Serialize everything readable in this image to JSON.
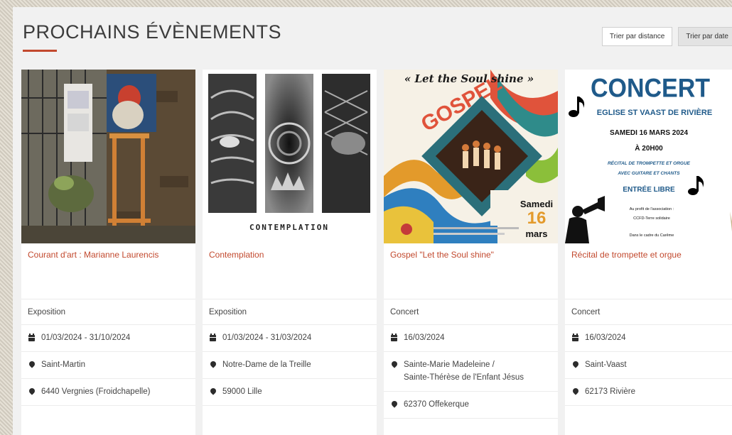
{
  "header": {
    "title": "PROCHAINS ÉVÈNEMENTS",
    "sort_distance": "Trier par distance",
    "sort_date": "Trier par date"
  },
  "colors": {
    "accent": "#c2492e",
    "text": "#444444",
    "panel": "#f1f1f1"
  },
  "events": [
    {
      "title": "Courant d'art : Marianne Laurencis",
      "category": "Exposition",
      "dates": "01/03/2024 - 31/10/2024",
      "place": "Saint-Martin",
      "place_line2": "",
      "locality": "6440 Vergnies (Froidchapelle)"
    },
    {
      "title": "Contemplation",
      "category": "Exposition",
      "dates": "01/03/2024 - 31/03/2024",
      "place": "Notre-Dame de la Treille",
      "place_line2": "",
      "locality": "59000 Lille",
      "poster_caption": "CONTEMPLATION"
    },
    {
      "title": "Gospel \"Let the Soul shine\"",
      "category": "Concert",
      "dates": "16/03/2024",
      "place": "Sainte-Marie Madeleine /",
      "place_line2": "Sainte-Thérèse de l'Enfant Jésus",
      "locality": "62370 Offekerque",
      "poster": {
        "script": "« Let the Soul shine »",
        "word": "GOSPEL",
        "day": "Samedi",
        "num": "16",
        "month": "mars"
      }
    },
    {
      "title": "Récital de trompette et orgue",
      "category": "Concert",
      "dates": "16/03/2024",
      "place": "Saint-Vaast",
      "place_line2": "",
      "locality": "62173 Rivière",
      "poster": {
        "heading": "CONCERT",
        "church": "EGLISE ST VAAST DE RIVIÈRE",
        "date": "SAMEDI 16 MARS 2024",
        "time": "À 20H00",
        "line1": "RÉCITAL DE TROMPETTE ET ORGUE",
        "line2": "AVEC GUITARE ET CHANTS",
        "entry": "ENTRÉE LIBRE",
        "benefit1": "Au profit de l'association :",
        "benefit2": "CCFD-Terre solidaire",
        "frame": "Dans le cadre du Carême"
      }
    }
  ]
}
